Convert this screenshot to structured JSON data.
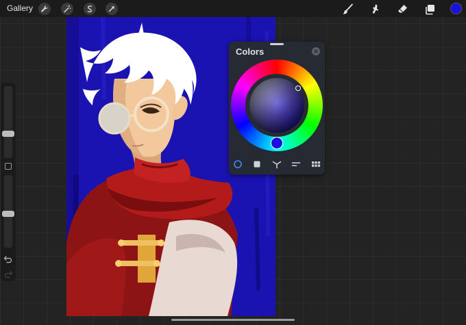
{
  "app": {
    "gallery_label": "Gallery",
    "current_color": "#1a10e0"
  },
  "toolbar": {
    "left_tools": [
      {
        "name": "actions",
        "icon": "wrench-icon"
      },
      {
        "name": "adjustments",
        "icon": "magic-wand-icon"
      },
      {
        "name": "selection",
        "icon": "selection-s-icon"
      },
      {
        "name": "transform",
        "icon": "transform-arrow-icon"
      }
    ],
    "right_tools": [
      {
        "name": "brush",
        "icon": "brush-icon"
      },
      {
        "name": "smudge",
        "icon": "smudge-icon"
      },
      {
        "name": "eraser",
        "icon": "eraser-icon"
      },
      {
        "name": "layers",
        "icon": "layers-icon"
      }
    ]
  },
  "sidebar": {
    "brush_size_level": 0.34,
    "opacity_level": 0.47,
    "undo_icon": "undo-icon",
    "redo_icon": "redo-icon"
  },
  "colors_panel": {
    "title": "Colors",
    "mode_tabs": [
      {
        "name": "disc",
        "icon": "disc-mode-icon",
        "active": true
      },
      {
        "name": "classic",
        "icon": "classic-mode-icon",
        "active": false
      },
      {
        "name": "harmony",
        "icon": "harmony-mode-icon",
        "active": false
      },
      {
        "name": "value",
        "icon": "value-mode-icon",
        "active": false
      },
      {
        "name": "palettes",
        "icon": "palettes-mode-icon",
        "active": false
      }
    ],
    "accent_color": "#3d8bff"
  }
}
